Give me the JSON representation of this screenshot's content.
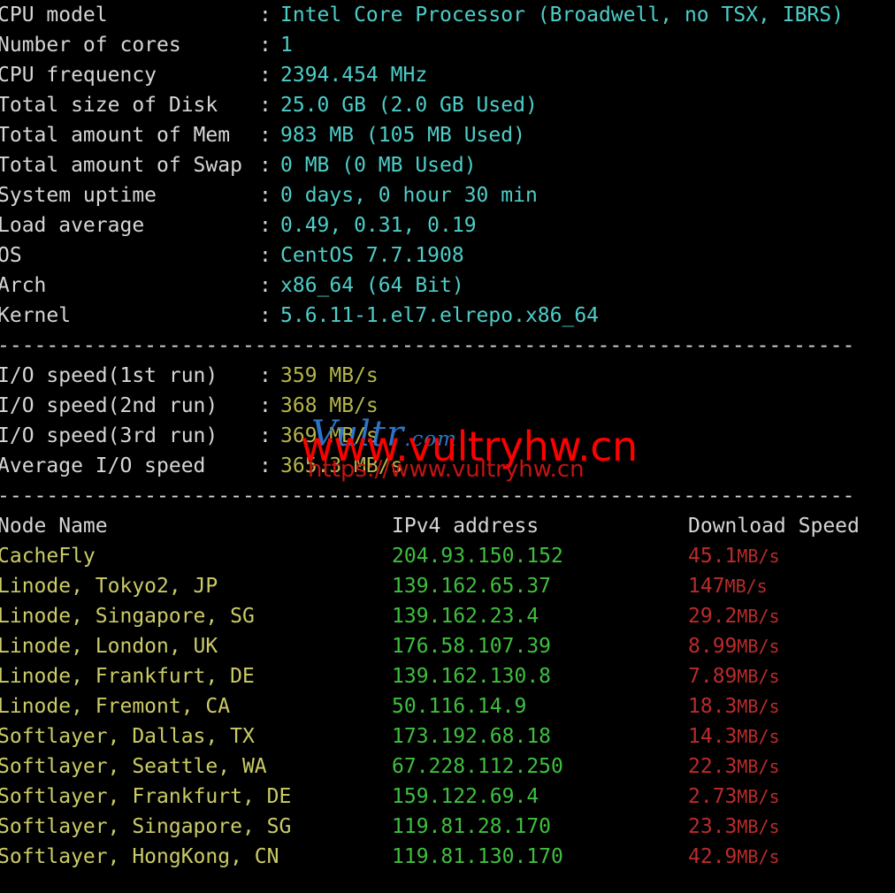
{
  "terminal": {
    "background": "#000000",
    "label_color": "#d6d6d6",
    "value_color": "#4ecdc8",
    "io_value_color": "#b5b54a",
    "node_name_color": "#cbcb68",
    "ip_color": "#3fbf3f",
    "speed_color": "#bb2b2b",
    "separator": "----------------------------------------------------------------------"
  },
  "system_info": [
    {
      "label": "CPU model",
      "colon": ":",
      "value": "Intel Core Processor (Broadwell, no TSX, IBRS)"
    },
    {
      "label": "Number of cores",
      "colon": ":",
      "value": "1"
    },
    {
      "label": "CPU frequency",
      "colon": ":",
      "value": "2394.454 MHz"
    },
    {
      "label": "Total size of Disk",
      "colon": ":",
      "value": "25.0 GB (2.0 GB Used)"
    },
    {
      "label": "Total amount of Mem",
      "colon": ":",
      "value": "983 MB (105 MB Used)"
    },
    {
      "label": "Total amount of Swap",
      "colon": ":",
      "value": "0 MB (0 MB Used)"
    },
    {
      "label": "System uptime",
      "colon": ":",
      "value": "0 days, 0 hour 30 min"
    },
    {
      "label": "Load average",
      "colon": ":",
      "value": "0.49, 0.31, 0.19"
    },
    {
      "label": "OS",
      "colon": ":",
      "value": "CentOS 7.7.1908"
    },
    {
      "label": "Arch",
      "colon": ":",
      "value": "x86_64 (64 Bit)"
    },
    {
      "label": "Kernel",
      "colon": ":",
      "value": "5.6.11-1.el7.elrepo.x86_64"
    }
  ],
  "io_speed": [
    {
      "label": "I/O speed(1st run)",
      "colon": ":",
      "value": "359 MB/s"
    },
    {
      "label": "I/O speed(2nd run)",
      "colon": ":",
      "value": "368 MB/s"
    },
    {
      "label": "I/O speed(3rd run)",
      "colon": ":",
      "value": "369 MB/s"
    },
    {
      "label": "Average I/O speed",
      "colon": ":",
      "value": "365.3 MB/s"
    }
  ],
  "node_table": {
    "headers": {
      "node_name": "Node Name",
      "ipv4": "IPv4 address",
      "speed": "Download Speed"
    },
    "rows": [
      {
        "node_name": "CacheFly",
        "ipv4": "204.93.150.152",
        "speed_value": "45.1",
        "speed_unit": "MB/s"
      },
      {
        "node_name": "Linode, Tokyo2, JP",
        "ipv4": "139.162.65.37",
        "speed_value": "147",
        "speed_unit": "MB/s"
      },
      {
        "node_name": "Linode, Singapore, SG",
        "ipv4": "139.162.23.4",
        "speed_value": "29.2",
        "speed_unit": "MB/s"
      },
      {
        "node_name": "Linode, London, UK",
        "ipv4": "176.58.107.39",
        "speed_value": "8.99",
        "speed_unit": "MB/s"
      },
      {
        "node_name": "Linode, Frankfurt, DE",
        "ipv4": "139.162.130.8",
        "speed_value": "7.89",
        "speed_unit": "MB/s"
      },
      {
        "node_name": "Linode, Fremont, CA",
        "ipv4": "50.116.14.9",
        "speed_value": "18.3",
        "speed_unit": "MB/s"
      },
      {
        "node_name": "Softlayer, Dallas, TX",
        "ipv4": "173.192.68.18",
        "speed_value": "14.3",
        "speed_unit": "MB/s"
      },
      {
        "node_name": "Softlayer, Seattle, WA",
        "ipv4": "67.228.112.250",
        "speed_value": "22.3",
        "speed_unit": "MB/s"
      },
      {
        "node_name": "Softlayer, Frankfurt, DE",
        "ipv4": "159.122.69.4",
        "speed_value": "2.73",
        "speed_unit": "MB/s"
      },
      {
        "node_name": "Softlayer, Singapore, SG",
        "ipv4": "119.81.28.170",
        "speed_value": "23.3",
        "speed_unit": "MB/s"
      },
      {
        "node_name": "Softlayer, HongKong, CN",
        "ipv4": "119.81.130.170",
        "speed_value": "42.9",
        "speed_unit": "MB/s"
      }
    ]
  },
  "watermark": {
    "brand_blue": "Vultr",
    "brand_blue_suffix": ".com",
    "main": "www.vultryhw.cn",
    "sub": "https://www.vultryhw.cn",
    "main_color": "#fe0000",
    "sub_color": "#c41313",
    "brand_blue_color": "#2f7fd8"
  }
}
